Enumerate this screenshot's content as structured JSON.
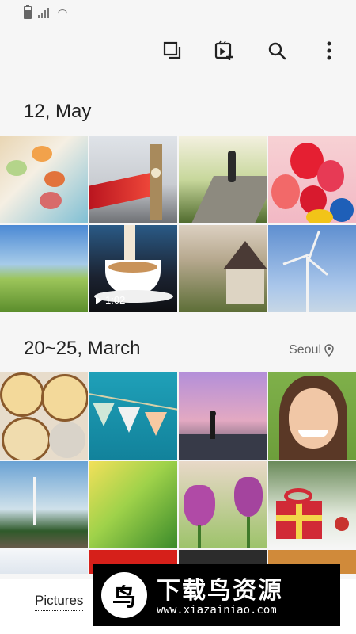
{
  "status_bar": {
    "icons": [
      "battery-icon",
      "signal-icon",
      "wifi-icon"
    ],
    "battery_level": 0.8
  },
  "toolbar": {
    "icons": [
      "select-icon",
      "create-story-icon",
      "search-icon",
      "more-options-icon"
    ]
  },
  "sections": [
    {
      "date": "12, May",
      "location": ""
    },
    {
      "date": "20~25, March",
      "location": "Seoul"
    }
  ],
  "video": {
    "duration": "1:02"
  },
  "bottom_nav": {
    "pictures_tab": "Pictures"
  },
  "watermark": {
    "logo_char": "鸟",
    "title": "下载鸟资源",
    "url": "www.xiazainiao.com"
  },
  "colors": {
    "accent": "#4a8fe0",
    "background": "#f6f6f6"
  }
}
